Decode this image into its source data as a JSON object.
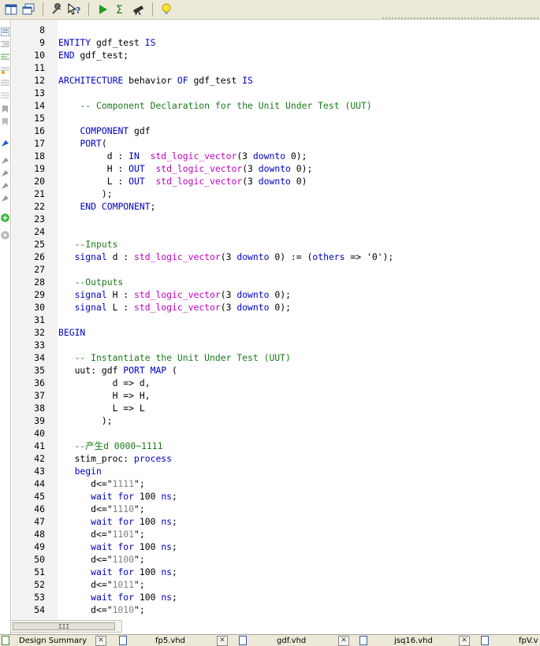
{
  "toolbar": {
    "icons": [
      "window-icon",
      "restore-window-icon",
      "wrench-icon",
      "help-pointer-icon",
      "run-icon",
      "sigma-icon",
      "telescope-icon",
      "lightbulb-icon"
    ],
    "colors": {
      "run": "#1e9e1e",
      "sigma": "#1a7a1a"
    }
  },
  "editor": {
    "lines": [
      {
        "n": "8",
        "t": ""
      },
      {
        "n": "9",
        "t": "ENTITY gdf_test IS"
      },
      {
        "n": "10",
        "t": "END gdf_test;"
      },
      {
        "n": "11",
        "t": ""
      },
      {
        "n": "12",
        "t": "ARCHITECTURE behavior OF gdf_test IS"
      },
      {
        "n": "13",
        "t": ""
      },
      {
        "n": "14",
        "t": "    -- Component Declaration for the Unit Under Test (UUT)"
      },
      {
        "n": "15",
        "t": ""
      },
      {
        "n": "16",
        "t": "    COMPONENT gdf"
      },
      {
        "n": "17",
        "t": "    PORT("
      },
      {
        "n": "18",
        "t": "         d : IN  std_logic_vector(3 downto 0);"
      },
      {
        "n": "19",
        "t": "         H : OUT  std_logic_vector(3 downto 0);"
      },
      {
        "n": "20",
        "t": "         L : OUT  std_logic_vector(3 downto 0)"
      },
      {
        "n": "21",
        "t": "        );"
      },
      {
        "n": "22",
        "t": "    END COMPONENT;"
      },
      {
        "n": "23",
        "t": ""
      },
      {
        "n": "24",
        "t": ""
      },
      {
        "n": "25",
        "t": "   --Inputs"
      },
      {
        "n": "26",
        "t": "   signal d : std_logic_vector(3 downto 0) := (others => '0');"
      },
      {
        "n": "27",
        "t": ""
      },
      {
        "n": "28",
        "t": "   --Outputs"
      },
      {
        "n": "29",
        "t": "   signal H : std_logic_vector(3 downto 0);"
      },
      {
        "n": "30",
        "t": "   signal L : std_logic_vector(3 downto 0);"
      },
      {
        "n": "31",
        "t": ""
      },
      {
        "n": "32",
        "t": "BEGIN"
      },
      {
        "n": "33",
        "t": ""
      },
      {
        "n": "34",
        "t": "   -- Instantiate the Unit Under Test (UUT)"
      },
      {
        "n": "35",
        "t": "   uut: gdf PORT MAP ("
      },
      {
        "n": "36",
        "t": "          d => d,"
      },
      {
        "n": "37",
        "t": "          H => H,"
      },
      {
        "n": "38",
        "t": "          L => L"
      },
      {
        "n": "39",
        "t": "        );"
      },
      {
        "n": "40",
        "t": ""
      },
      {
        "n": "41",
        "t": "   --产生d 0000~1111"
      },
      {
        "n": "42",
        "t": "   stim_proc: process"
      },
      {
        "n": "43",
        "t": "   begin"
      },
      {
        "n": "44",
        "t": "      d<=\"1111\";"
      },
      {
        "n": "45",
        "t": "      wait for 100 ns;"
      },
      {
        "n": "46",
        "t": "      d<=\"1110\";"
      },
      {
        "n": "47",
        "t": "      wait for 100 ns;"
      },
      {
        "n": "48",
        "t": "      d<=\"1101\";"
      },
      {
        "n": "49",
        "t": "      wait for 100 ns;"
      },
      {
        "n": "50",
        "t": "      d<=\"1100\";"
      },
      {
        "n": "51",
        "t": "      wait for 100 ns;"
      },
      {
        "n": "52",
        "t": "      d<=\"1011\";"
      },
      {
        "n": "53",
        "t": "      wait for 100 ns;"
      },
      {
        "n": "54",
        "t": "      d<=\"1010\";"
      }
    ],
    "syntax_colors": {
      "keyword": "#0000c0",
      "comment": "#1a7a1a",
      "type": "#c000c0",
      "string": "#808080",
      "highlight": "#cc0000"
    }
  },
  "tabs": [
    {
      "label": "Design Summary",
      "icon": "design-summary-icon"
    },
    {
      "label": "fp5.vhd",
      "icon": "vhdl-file-icon"
    },
    {
      "label": "gdf.vhd",
      "icon": "vhdl-file-icon"
    },
    {
      "label": "jsq16.vhd",
      "icon": "vhdl-file-icon"
    },
    {
      "label": "fpV.v",
      "icon": "vhdl-file-icon"
    }
  ],
  "scrollbar": {
    "grip": "III"
  }
}
